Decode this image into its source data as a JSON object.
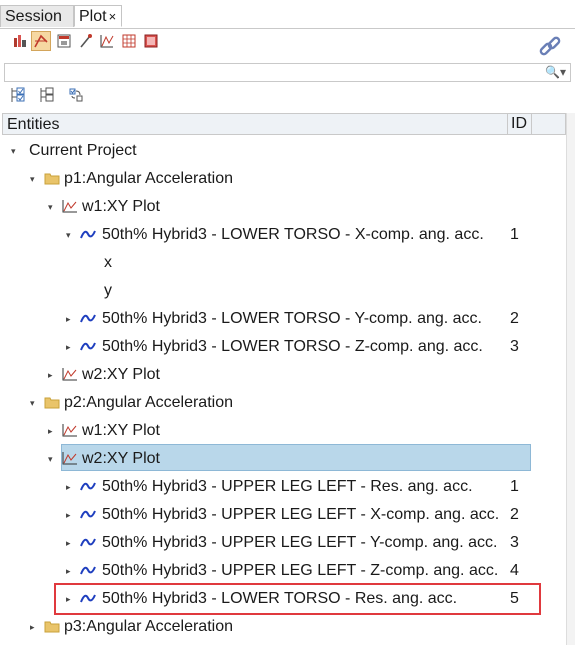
{
  "tabs": [
    {
      "label": "Session"
    },
    {
      "label": "Plot",
      "close": "×"
    }
  ],
  "toolbar": {
    "icons": [
      "plot-create-icon",
      "curve-edit-icon",
      "window-icon",
      "probe-icon",
      "axis-icon",
      "grid-icon",
      "frame-icon"
    ],
    "link_icon": "link-icon"
  },
  "search": {
    "value": "",
    "placeholder": "",
    "icon": "search-icon"
  },
  "row2_icons": [
    "expand-all-icon",
    "collapse-all-icon",
    "sync-icon"
  ],
  "header": {
    "entities": "Entities",
    "id": "ID"
  },
  "tree": {
    "current_project": "Current Project",
    "p1": "p1:Angular Acceleration",
    "p1_w1": "w1:XY Plot",
    "p1_w1_c1": {
      "label": "50th% Hybrid3   - LOWER TORSO - X-comp. ang. acc.",
      "id": "1"
    },
    "x": "x",
    "y": "y",
    "p1_w1_c2": {
      "label": "50th% Hybrid3   - LOWER TORSO - Y-comp. ang. acc.",
      "id": "2"
    },
    "p1_w1_c3": {
      "label": "50th% Hybrid3   - LOWER TORSO - Z-comp. ang. acc.",
      "id": "3"
    },
    "p1_w2": "w2:XY Plot",
    "p2": "p2:Angular Acceleration",
    "p2_w1": "w1:XY Plot",
    "p2_w2": "w2:XY Plot",
    "p2_w2_c1": {
      "label": "50th% Hybrid3   - UPPER LEG LEFT - Res. ang. acc.",
      "id": "1"
    },
    "p2_w2_c2": {
      "label": "50th% Hybrid3   - UPPER LEG LEFT - X-comp. ang. acc.",
      "id": "2"
    },
    "p2_w2_c3": {
      "label": "50th% Hybrid3   - UPPER LEG LEFT - Y-comp. ang. acc.",
      "id": "3"
    },
    "p2_w2_c4": {
      "label": "50th% Hybrid3   - UPPER LEG LEFT - Z-comp. ang. acc.",
      "id": "4"
    },
    "p2_w2_c5": {
      "label": "50th% Hybrid3   - LOWER TORSO - Res. ang. acc.",
      "id": "5"
    },
    "p3": "p3:Angular Acceleration"
  },
  "colors": {
    "selection": "#b9d7ea",
    "highlight": "#e0393e",
    "curve": "#1f3fbf",
    "folder": "#e9c46a",
    "plot_icon": "#c0392b"
  }
}
